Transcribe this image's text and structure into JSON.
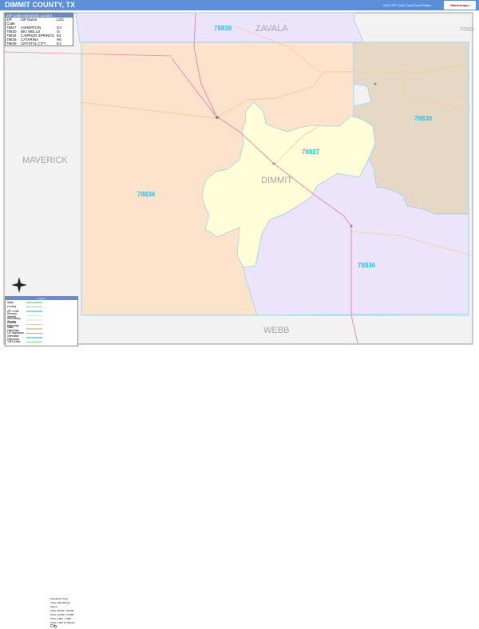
{
  "header": {
    "title": "DIMMIT COUNTY, TX",
    "edition": "2022 ZIP Code Color/Cast Edition",
    "logo": "Marketmaps"
  },
  "zip_index": {
    "heading": "ZIP Code Index/Grid Locator",
    "columns": [
      "ZIP Code",
      "ZIP Name",
      "LOC"
    ],
    "rows": [
      [
        "78827",
        "ASHERTON",
        "G4"
      ],
      [
        "78830",
        "BIG WELLS",
        "I3"
      ],
      [
        "78834",
        "CARRIZO SPRINGS",
        "E4"
      ],
      [
        "78836",
        "CATARINA",
        "H6"
      ],
      [
        "78839",
        "CRYSTAL CITY",
        "E1"
      ]
    ]
  },
  "map": {
    "counties": {
      "center": "DIMMIT",
      "north": "ZAVALA",
      "northeast": "FRIO",
      "west": "MAVERICK",
      "south": "WEBB"
    },
    "zip_labels": {
      "z78839": "78839",
      "z78834": "78834",
      "z78827": "78827",
      "z78830": "78830",
      "z78836": "78836"
    },
    "colors": {
      "z78834": "#fde2cc",
      "z78827": "#fffed6",
      "z78830": "#e7d8c5",
      "z78836": "#ebe4fa",
      "z78839": "#ebe4fa",
      "outside": "#f2f2f2",
      "zip_border": "#8fd8ea",
      "us_highway": "#f080b0",
      "state_highway": "#f8c898"
    }
  },
  "legend": {
    "heading": "Legend",
    "items": [
      {
        "label": "State",
        "color": "#9ee49e"
      },
      {
        "label": "County",
        "color": "#bbbbbb"
      },
      {
        "label": "ZIP Code",
        "color": "#8fd8ea"
      },
      {
        "label": "Primary Streets",
        "color": "#dddddd"
      },
      {
        "label": "Secondary Streets",
        "color": "#eeeeee"
      },
      {
        "label": "County Highways",
        "color": "#cccccc"
      },
      {
        "label": "State Highways",
        "color": "#f8c898"
      },
      {
        "label": "US Highways",
        "color": "#f080b0"
      },
      {
        "label": "Interstate Highways",
        "color": "#8fc8f0"
      },
      {
        "label": "Toll Roads",
        "color": "#80e080"
      }
    ],
    "population_heading": "Population Icons",
    "population": [
      "Cities 100,000 and Above",
      "Cities 25,000 - 99,999",
      "Cities 10,000 - 24,999",
      "Cities 1,000 - 9,999",
      "Cities 1,000 and Below"
    ],
    "city_icon_label": "City"
  }
}
